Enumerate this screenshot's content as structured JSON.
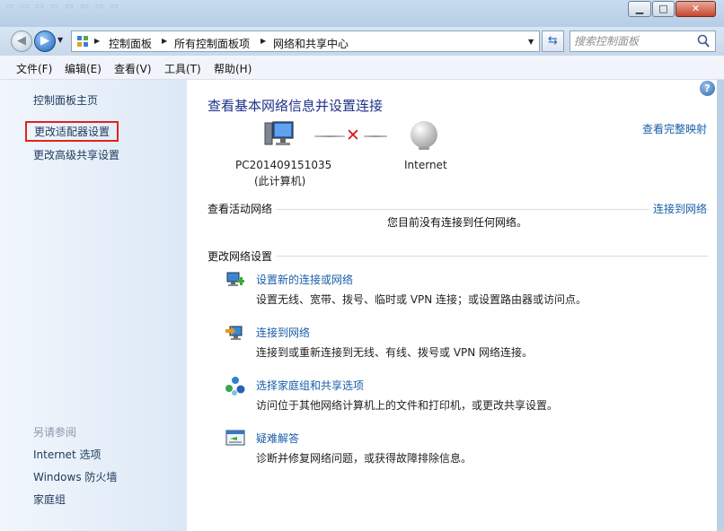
{
  "window": {
    "minimize_glyph": "▁",
    "maximize_glyph": "□",
    "close_glyph": "✕"
  },
  "address_bar": {
    "breadcrumbs": [
      "控制面板",
      "所有控制面板项",
      "网络和共享中心"
    ],
    "search_placeholder": "搜索控制面板"
  },
  "menu": {
    "items": [
      "文件(F)",
      "编辑(E)",
      "查看(V)",
      "工具(T)",
      "帮助(H)"
    ]
  },
  "sidebar": {
    "home": "控制面板主页",
    "adapter_settings": "更改适配器设置",
    "advanced_sharing": "更改高级共享设置",
    "see_also_title": "另请参阅",
    "see_also": [
      "Internet 选项",
      "Windows 防火墙",
      "家庭组"
    ]
  },
  "main": {
    "title": "查看基本网络信息并设置连接",
    "full_map": "查看完整映射",
    "computer_name": "PC201409151035",
    "computer_sub": "(此计算机)",
    "internet": "Internet",
    "active_networks": "查看活动网络",
    "connect_link": "连接到网络",
    "no_connection": "您目前没有连接到任何网络。",
    "change_settings": "更改网络设置",
    "tasks": [
      {
        "link": "设置新的连接或网络",
        "desc": "设置无线、宽带、拨号、临时或 VPN 连接；或设置路由器或访问点。"
      },
      {
        "link": "连接到网络",
        "desc": "连接到或重新连接到无线、有线、拨号或 VPN 网络连接。"
      },
      {
        "link": "选择家庭组和共享选项",
        "desc": "访问位于其他网络计算机上的文件和打印机，或更改共享设置。"
      },
      {
        "link": "疑难解答",
        "desc": "诊断并修复网络问题，或获得故障排除信息。"
      }
    ]
  },
  "colors": {
    "link": "#1a5ea8",
    "title": "#1e3287",
    "highlight_border": "#e2231a",
    "disconnected": "#e0151e"
  }
}
